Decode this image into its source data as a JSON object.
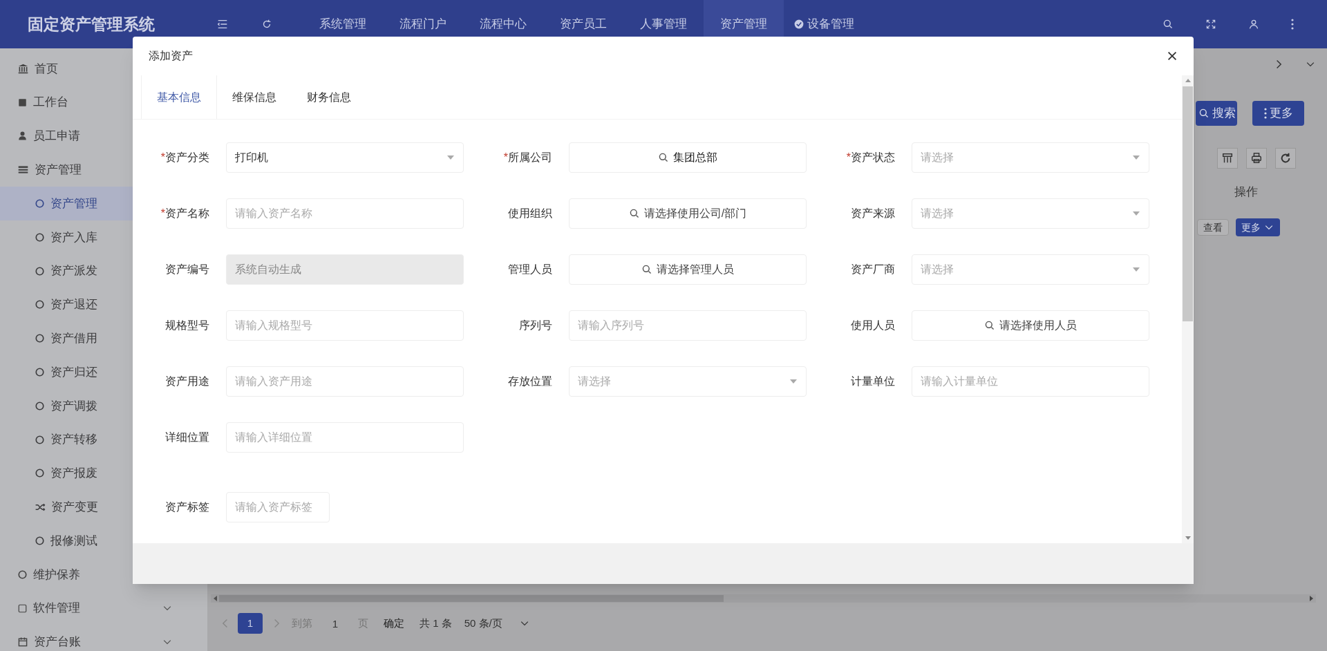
{
  "header": {
    "logo": "固定资产管理系统",
    "nav": [
      {
        "label": "系统管理",
        "selected": false
      },
      {
        "label": "流程门户",
        "selected": false
      },
      {
        "label": "流程中心",
        "selected": false
      },
      {
        "label": "资产员工",
        "selected": false
      },
      {
        "label": "人事管理",
        "selected": false
      },
      {
        "label": "资产管理",
        "selected": true
      },
      {
        "label": "设备管理",
        "selected": false,
        "kind": "checked"
      }
    ]
  },
  "sidebar": {
    "items": [
      {
        "label": "首页"
      },
      {
        "label": "工作台"
      },
      {
        "label": "员工申请"
      },
      {
        "label": "资产管理",
        "expanded": true,
        "children": [
          {
            "label": "资产管理",
            "selected": true
          },
          {
            "label": "资产入库",
            "selected": false
          },
          {
            "label": "资产派发",
            "selected": false
          },
          {
            "label": "资产退还",
            "selected": false
          },
          {
            "label": "资产借用",
            "selected": false
          },
          {
            "label": "资产归还",
            "selected": false
          },
          {
            "label": "资产调拨",
            "selected": false
          },
          {
            "label": "资产转移",
            "selected": false
          },
          {
            "label": "资产报废",
            "selected": false
          },
          {
            "label": "资产变更",
            "selected": false
          },
          {
            "label": "报修测试",
            "selected": false
          }
        ]
      },
      {
        "label": "维护保养"
      },
      {
        "label": "软件管理",
        "expanded": false
      },
      {
        "label": "资产台账",
        "expanded": false
      }
    ]
  },
  "toolbar": {
    "search_button": "搜索",
    "more_button": "更多"
  },
  "table": {
    "columns": [
      "操作"
    ],
    "row_actions": [
      "查看",
      "更多"
    ]
  },
  "pagination": {
    "pages": [
      {
        "label": "1",
        "selected": true
      }
    ],
    "goto_label": "到第",
    "goto_value": "1",
    "page_unit": "页",
    "confirm": "确定",
    "total": "共 1 条",
    "page_size": "50 条/页"
  },
  "modal": {
    "title": "添加资产",
    "tabs": [
      {
        "label": "基本信息",
        "selected": true
      },
      {
        "label": "维保信息",
        "selected": false
      },
      {
        "label": "财务信息",
        "selected": false
      }
    ],
    "rows": [
      [
        {
          "label": "资产分类",
          "mark": "*",
          "kind": "select",
          "value": "打印机"
        },
        {
          "label": "所属公司",
          "mark": "*",
          "kind": "lookup",
          "value": "集团总部"
        },
        {
          "label": "资产状态",
          "mark": "*",
          "kind": "select",
          "placeholder": "请选择"
        }
      ],
      [
        {
          "label": "资产名称",
          "mark": "*",
          "kind": "input",
          "placeholder": "请输入资产名称"
        },
        {
          "label": "使用组织",
          "kind": "lookup",
          "placeholder": "请选择使用公司/部门"
        },
        {
          "label": "资产来源",
          "kind": "select",
          "placeholder": "请选择"
        }
      ],
      [
        {
          "label": "资产编号",
          "kind": "readonly",
          "placeholder": "系统自动生成"
        },
        {
          "label": "管理人员",
          "kind": "lookup",
          "placeholder": "请选择管理人员"
        },
        {
          "label": "资产厂商",
          "kind": "select",
          "placeholder": "请选择"
        }
      ],
      [
        {
          "label": "规格型号",
          "kind": "input",
          "placeholder": "请输入规格型号"
        },
        {
          "label": "序列号",
          "kind": "input",
          "placeholder": "请输入序列号"
        },
        {
          "label": "使用人员",
          "kind": "lookup",
          "placeholder": "请选择使用人员"
        }
      ],
      [
        {
          "label": "资产用途",
          "kind": "input",
          "placeholder": "请输入资产用途"
        },
        {
          "label": "存放位置",
          "kind": "select",
          "placeholder": "请选择"
        },
        {
          "label": "计量单位",
          "kind": "input",
          "placeholder": "请输入计量单位"
        }
      ],
      [
        {
          "label": "详细位置",
          "kind": "input",
          "placeholder": "请输入详细位置"
        }
      ],
      [
        {
          "label": "资产标签",
          "kind": "tags",
          "placeholder": "请输入资产标签"
        }
      ]
    ]
  }
}
